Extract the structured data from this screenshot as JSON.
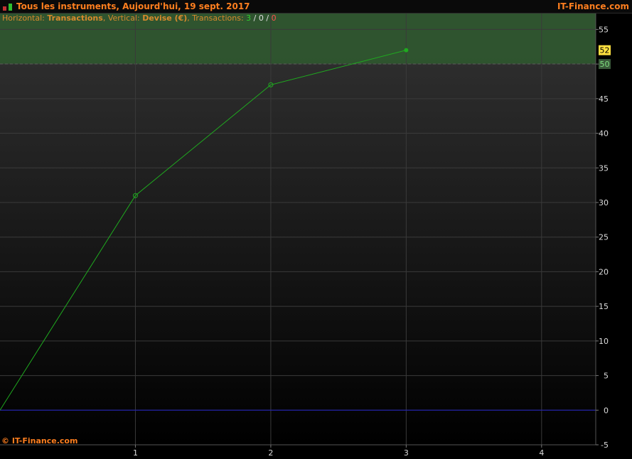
{
  "header": {
    "title": "Tous les instruments, Aujourd'hui, 19 sept. 2017",
    "brand": "IT-Finance.com"
  },
  "info": {
    "horizontal_prefix": "Horizontal:",
    "horizontal_value": "Transactions",
    "vertical_prefix": "Vertical:",
    "vertical_value": "Devise (€)",
    "transactions_prefix": "Transactions:",
    "count_win": "3",
    "count_neutral": "0",
    "count_loss": "0",
    "separator": "/"
  },
  "footer": {
    "copyright": "© IT-Finance.com"
  },
  "colors": {
    "accent": "#ff7f1f",
    "line": "#1faa1f",
    "target_zone": "#2f5a2f",
    "zero_line": "#2020c0",
    "current_badge": "#ffe040"
  },
  "chart_data": {
    "type": "line",
    "xlabel": "",
    "ylabel": "",
    "x": [
      0,
      1,
      2,
      3
    ],
    "values": [
      0,
      31,
      47,
      52
    ],
    "xlim": [
      0,
      4.4
    ],
    "ylim": [
      -5,
      57.3
    ],
    "x_ticks": [
      "1",
      "2",
      "3",
      "4"
    ],
    "y_ticks": [
      "55",
      "50",
      "45",
      "40",
      "35",
      "30",
      "25",
      "20",
      "15",
      "10",
      "5",
      "0",
      "-5"
    ],
    "y_tick_values": [
      55,
      50,
      45,
      40,
      35,
      30,
      25,
      20,
      15,
      10,
      5,
      0,
      -5
    ],
    "x_tick_values": [
      1,
      2,
      3,
      4
    ],
    "target_level": 50,
    "target_label": "50",
    "current_value": 52,
    "current_label": "52",
    "zero_line": 0,
    "grid": true
  }
}
